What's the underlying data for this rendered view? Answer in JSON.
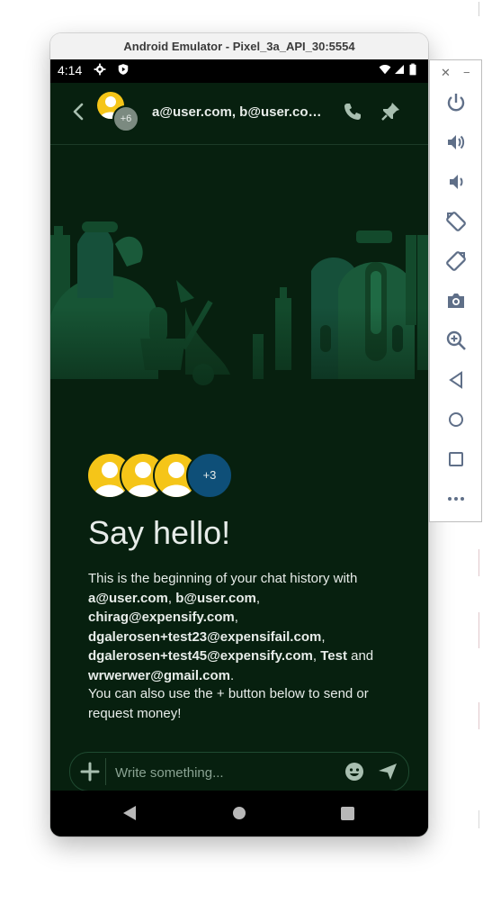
{
  "window": {
    "title": "Android Emulator - Pixel_3a_API_30:5554"
  },
  "status_bar": {
    "time": "4:14"
  },
  "chat": {
    "header_title": "a@user.com, b@user.com, chirag@expensify.com, dgalerosen+test23@expensifail.com, dgalerosen+test45@expensify.com, Test and wrwerwer@gmail.com",
    "header_badge": "+6",
    "avatars_more": "+3",
    "say_hello": "Say hello!",
    "intro_prefix": "This is the beginning of your chat history with ",
    "participants": [
      "a@user.com",
      "b@user.com",
      "chirag@expensify.com",
      "dgalerosen+test23@expensifail.com",
      "dgalerosen+test45@expensify.com",
      "Test",
      "wrwerwer@gmail.com"
    ],
    "sep_comma": ", ",
    "sep_and": " and ",
    "intro_suffix": ".",
    "plus_hint": "You can also use the + button below to send or request money!",
    "composer_placeholder": "Write something..."
  },
  "toolbar": {
    "items": [
      "power",
      "volume-up",
      "volume-down",
      "rotate-left",
      "rotate-right",
      "screenshot",
      "zoom",
      "back",
      "home",
      "overview",
      "more"
    ]
  },
  "colors": {
    "background": "#07200f",
    "text": "#e7ece9",
    "avatar": "#f5c518",
    "more_badge": "#0e4f78"
  }
}
